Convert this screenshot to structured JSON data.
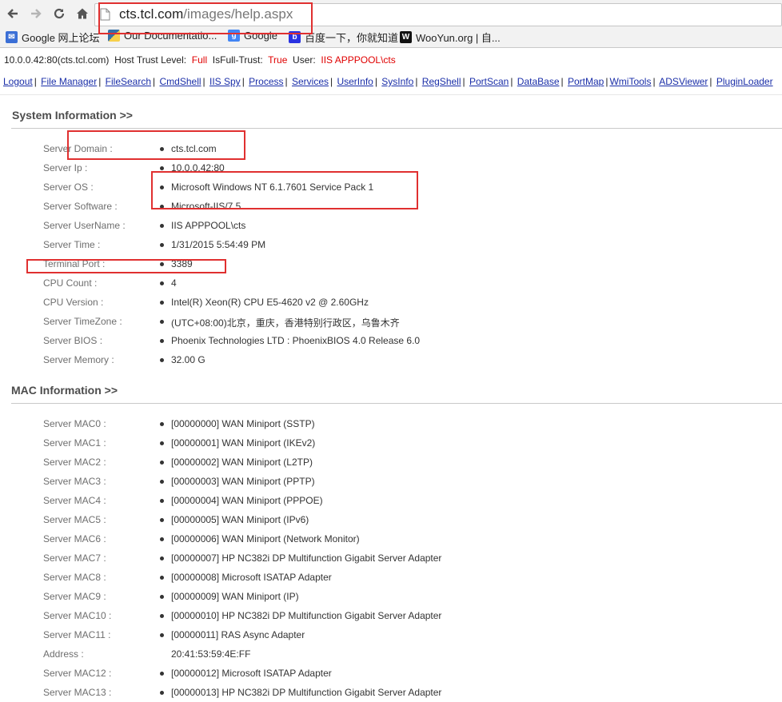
{
  "browser": {
    "url_domain": "cts.tcl.com",
    "url_path": "/images/help.aspx",
    "bookmarks": [
      {
        "label": "Google 网上论坛",
        "icon": "google-groups-icon",
        "color": "#3b6fd6"
      },
      {
        "label": "Our Documentatio...",
        "icon": "python-icon",
        "color": "#3570a8"
      },
      {
        "label": "Google",
        "icon": "google-icon",
        "color": "#4285f4"
      },
      {
        "label": "百度一下，你就知道",
        "icon": "baidu-icon",
        "color": "#2932e1"
      },
      {
        "label": "WooYun.org | 自...",
        "icon": "wooyun-icon",
        "color": "#111111"
      }
    ]
  },
  "status": {
    "host": "10.0.0.42:80(cts.tcl.com)",
    "trust_label": "Host Trust Level:",
    "trust_value": "Full",
    "fulltrust_label": "IsFull-Trust:",
    "fulltrust_value": "True",
    "user_label": "User:",
    "user_value": "IIS APPPOOL\\cts"
  },
  "nav_links": [
    "Logout",
    "File Manager",
    "FileSearch",
    "CmdShell",
    "IIS Spy",
    "Process",
    "Services",
    "UserInfo",
    "SysInfo",
    "RegShell",
    "PortScan",
    "DataBase",
    "PortMap",
    "WmiTools",
    "ADSViewer",
    "PluginLoader"
  ],
  "system": {
    "title": "System Information >>",
    "rows": [
      {
        "label": "Server Domain :",
        "value": "cts.tcl.com",
        "bullet": true
      },
      {
        "label": "Server Ip :",
        "value": "10.0.0.42:80",
        "bullet": true
      },
      {
        "label": "Server OS :",
        "value": "Microsoft Windows NT 6.1.7601 Service Pack 1",
        "bullet": true
      },
      {
        "label": "Server Software :",
        "value": "Microsoft-IIS/7.5",
        "bullet": true
      },
      {
        "label": "Server UserName :",
        "value": "IIS APPPOOL\\cts",
        "bullet": true
      },
      {
        "label": "Server Time :",
        "value": "1/31/2015 5:54:49 PM",
        "bullet": true
      },
      {
        "label": "Terminal Port :",
        "value": "3389",
        "bullet": true
      },
      {
        "label": "CPU Count :",
        "value": "4",
        "bullet": true
      },
      {
        "label": "CPU Version :",
        "value": "Intel(R) Xeon(R) CPU E5-4620 v2 @ 2.60GHz",
        "bullet": true
      },
      {
        "label": "Server TimeZone :",
        "value": "(UTC+08:00)北京，重庆，香港特别行政区，乌鲁木齐",
        "bullet": true
      },
      {
        "label": "Server BIOS :",
        "value": "Phoenix Technologies LTD : PhoenixBIOS 4.0 Release 6.0",
        "bullet": true
      },
      {
        "label": "Server Memory :",
        "value": "32.00 G",
        "bullet": true
      }
    ]
  },
  "mac": {
    "title": "MAC Information >>",
    "rows": [
      {
        "label": "Server MAC0 :",
        "value": "[00000000] WAN Miniport (SSTP)",
        "bullet": true
      },
      {
        "label": "Server MAC1 :",
        "value": "[00000001] WAN Miniport (IKEv2)",
        "bullet": true
      },
      {
        "label": "Server MAC2 :",
        "value": "[00000002] WAN Miniport (L2TP)",
        "bullet": true
      },
      {
        "label": "Server MAC3 :",
        "value": "[00000003] WAN Miniport (PPTP)",
        "bullet": true
      },
      {
        "label": "Server MAC4 :",
        "value": "[00000004] WAN Miniport (PPPOE)",
        "bullet": true
      },
      {
        "label": "Server MAC5 :",
        "value": "[00000005] WAN Miniport (IPv6)",
        "bullet": true
      },
      {
        "label": "Server MAC6 :",
        "value": "[00000006] WAN Miniport (Network Monitor)",
        "bullet": true
      },
      {
        "label": "Server MAC7 :",
        "value": "[00000007] HP NC382i DP Multifunction Gigabit Server Adapter",
        "bullet": true
      },
      {
        "label": "Server MAC8 :",
        "value": "[00000008] Microsoft ISATAP Adapter",
        "bullet": true
      },
      {
        "label": "Server MAC9 :",
        "value": "[00000009] WAN Miniport (IP)",
        "bullet": true
      },
      {
        "label": "Server MAC10 :",
        "value": "[00000010] HP NC382i DP Multifunction Gigabit Server Adapter",
        "bullet": true
      },
      {
        "label": "Server MAC11 :",
        "value": "[00000011] RAS Async Adapter",
        "bullet": true
      },
      {
        "label": "Address :",
        "value": "20:41:53:59:4E:FF",
        "bullet": false
      },
      {
        "label": "Server MAC12 :",
        "value": "[00000012] Microsoft ISATAP Adapter",
        "bullet": true
      },
      {
        "label": "Server MAC13 :",
        "value": "[00000013] HP NC382i DP Multifunction Gigabit Server Adapter",
        "bullet": true
      }
    ]
  }
}
